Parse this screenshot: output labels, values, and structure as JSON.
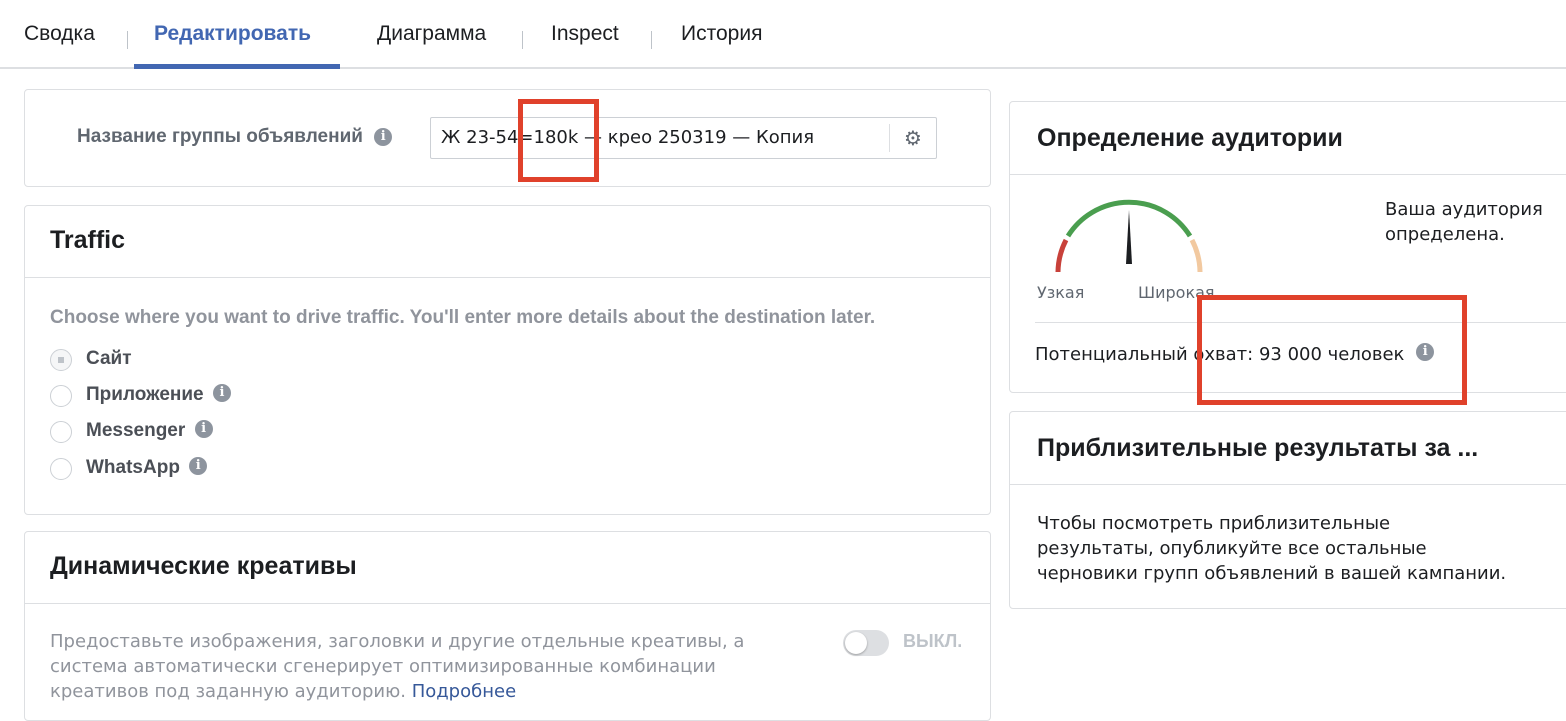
{
  "tabs": [
    {
      "label": "Сводка"
    },
    {
      "label": "Редактировать"
    },
    {
      "label": "Диаграмма"
    },
    {
      "label": "Inspect"
    },
    {
      "label": "История"
    }
  ],
  "adset_name": {
    "label": "Название группы объявлений",
    "value": "Ж 23-54=180k — крео 250319 — Копия"
  },
  "traffic": {
    "title": "Traffic",
    "description": "Choose where you want to drive traffic. You'll enter more details about the destination later.",
    "options": [
      {
        "label": "Сайт",
        "checked": true
      },
      {
        "label": "Приложение",
        "checked": false
      },
      {
        "label": "Messenger",
        "checked": false
      },
      {
        "label": "WhatsApp",
        "checked": false
      }
    ]
  },
  "dynamic": {
    "title": "Динамические креативы",
    "description": "Предоставьте изображения, заголовки и другие отдельные креативы, а система автоматически сгенерирует оптимизированные комбинации креативов под заданную аудиторию.",
    "link": "Подробнее",
    "toggle_label": "ВЫКЛ.",
    "toggle_on": false
  },
  "audience": {
    "title": "Определение аудитории",
    "gauge_left": "Узкая",
    "gauge_right": "Широкая",
    "status": "Ваша аудитория определена.",
    "reach": "Потенциальный охват: 93 000 человек"
  },
  "estimates": {
    "title": "Приблизительные результаты за ...",
    "description": "Чтобы посмотреть приблизительные результаты, опубликуйте все остальные черновики групп объявлений в вашей кампании."
  },
  "colors": {
    "accent": "#4267b2",
    "highlight": "#e0412b",
    "gauge_green": "#4a9e4f",
    "gauge_red": "#c8413a",
    "gauge_peach": "#f2c9a0"
  }
}
